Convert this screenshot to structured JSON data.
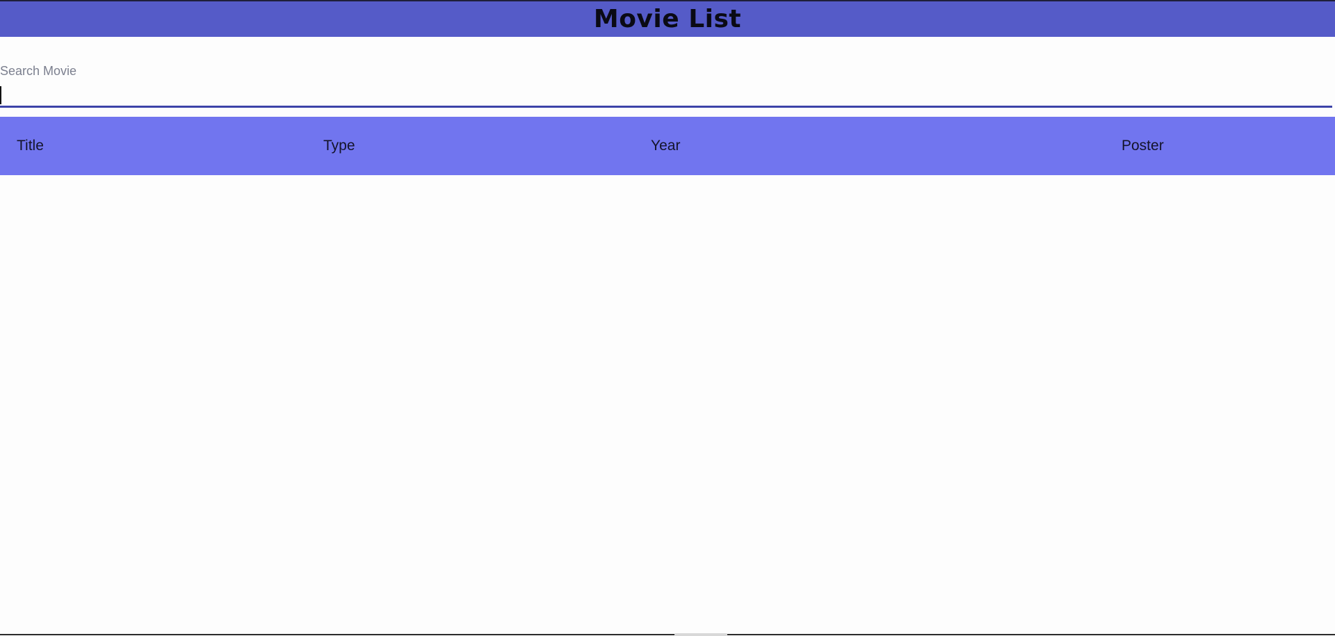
{
  "header": {
    "title": "Movie List"
  },
  "search": {
    "label": "Search Movie",
    "value": "",
    "placeholder": ""
  },
  "table": {
    "columns": [
      "Title",
      "Type",
      "Year",
      "Poster"
    ],
    "rows": []
  },
  "colors": {
    "header_bg": "#555bc8",
    "table_header_bg": "#7175ef",
    "input_underline": "#3c43a8",
    "label_text": "#7b7f8e"
  }
}
